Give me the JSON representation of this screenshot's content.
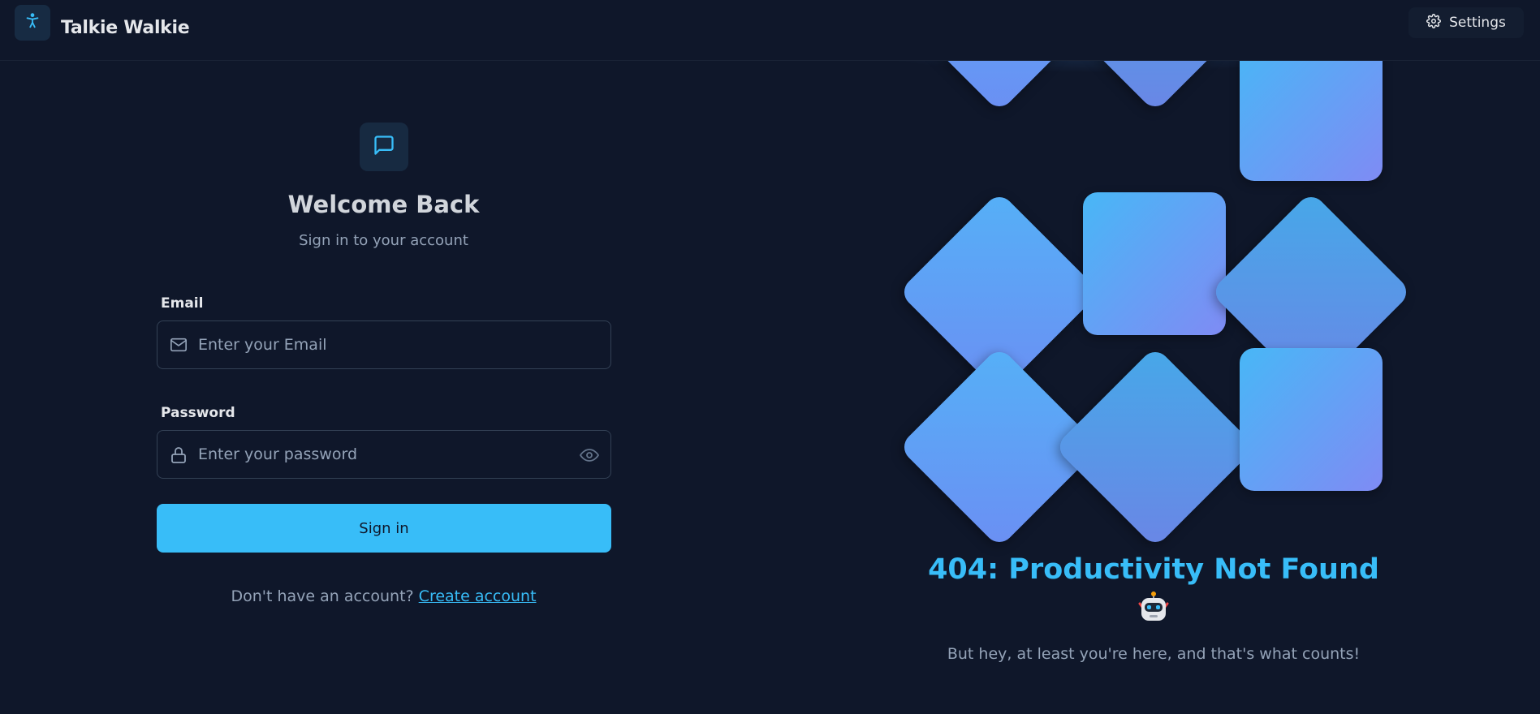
{
  "header": {
    "app_title": "Talkie Walkie",
    "settings_label": "Settings",
    "logo_icon": "accessibility-icon",
    "settings_icon": "gear-icon"
  },
  "login": {
    "chat_icon": "message-square-icon",
    "title": "Welcome Back",
    "subtitle": "Sign in to your account",
    "email": {
      "label": "Email",
      "placeholder": "Enter your Email",
      "value": "",
      "icon": "mail-icon"
    },
    "password": {
      "label": "Password",
      "placeholder": "Enter your password",
      "value": "",
      "icon": "lock-icon",
      "toggle_icon": "eye-icon"
    },
    "submit_label": "Sign in",
    "signup_prompt": "Don't have an account?",
    "signup_link": "Create account"
  },
  "promo": {
    "headline": "404: Productivity Not Found",
    "emoji_icon": "robot-icon",
    "message": "But hey, at least you're here, and that's what counts!"
  },
  "colors": {
    "background": "#0f172a",
    "accent": "#38bdf8",
    "muted_text": "#94a3b8",
    "tile_gradient_start": "#48b7f6",
    "tile_gradient_end": "#7f8bf4"
  }
}
